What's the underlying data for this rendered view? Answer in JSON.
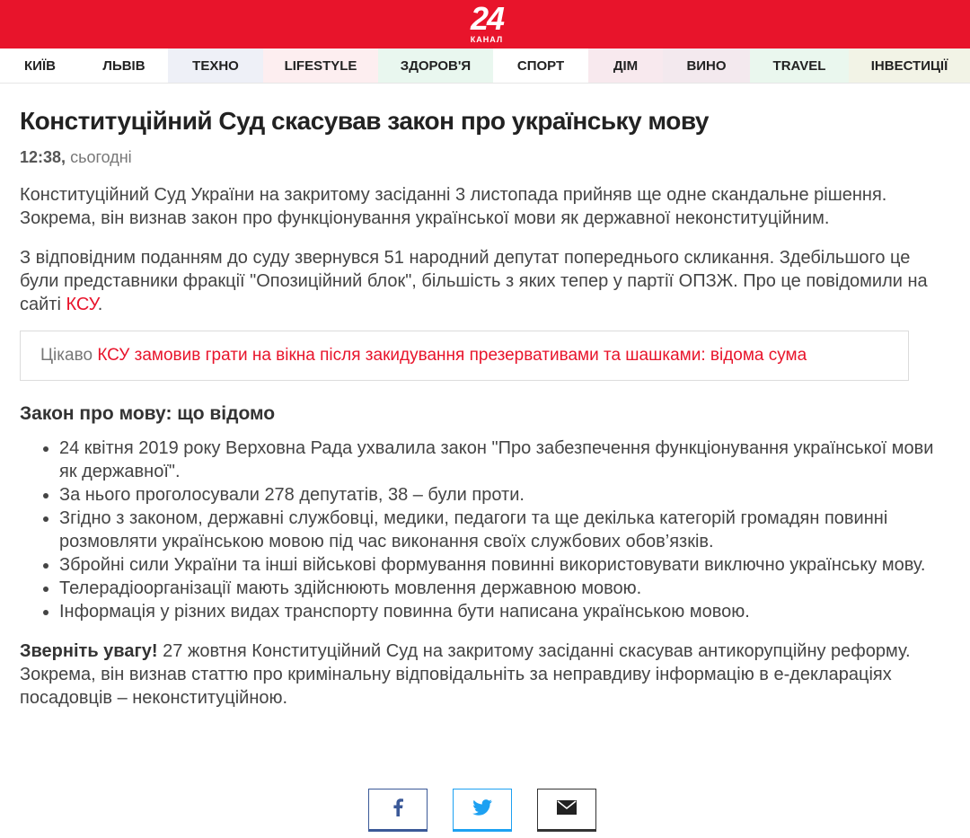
{
  "brand": {
    "logo_number": "24",
    "logo_sub": "КАНАЛ",
    "color": "#e8142b"
  },
  "nav": [
    {
      "label": "Київ",
      "bg": "#ffffff",
      "width": 89
    },
    {
      "label": "Львів",
      "bg": "#ffffff",
      "width": 98
    },
    {
      "label": "Техно",
      "bg": "#eef0f7",
      "width": 106
    },
    {
      "label": "Lifestyle",
      "bg": "#fdeef0",
      "width": 128
    },
    {
      "label": "Здоров'я",
      "bg": "#e9f7ef",
      "width": 128
    },
    {
      "label": "Спорт",
      "bg": "#ffffff",
      "width": 106
    },
    {
      "label": "Дім",
      "bg": "#f8e9ee",
      "width": 83
    },
    {
      "label": "Вино",
      "bg": "#f3e9ee",
      "width": 97
    },
    {
      "label": "Travel",
      "bg": "#eaf7ee",
      "width": 110
    },
    {
      "label": "Інвестиції",
      "bg": "#f2f3e6",
      "width": 135
    }
  ],
  "article": {
    "title": "Конституційний Суд скасував закон про українську мову",
    "time": "12:38,",
    "date": "сьогодні",
    "p1": "Конституційний Суд України на закритому засіданні 3 листопада прийняв ще одне скандальне рішення. Зокрема, він визнав закон про функціонування української мови як державної неконституційним.",
    "p2_text": "З відповідним поданням до суду звернувся 51 народний депутат попереднього скликання. Здебільшого це були представники фракції \"Опозиційний блок\", більшість з яких тепер у партії ОПЗЖ. Про це повідомили на сайті",
    "p2_link": "КСУ",
    "p2_end": ".",
    "interesting_label": "Цікаво",
    "interesting_link": "КСУ замовив грати на вікна після закидування презервативами та шашками: відома сума",
    "section_title": "Закон про мову: що відомо",
    "bullets": [
      "24 квітня 2019 року Верховна Рада ухвалила закон \"Про забезпечення функціонування української мови як державної\".",
      "За нього проголосували 278 депутатів, 38 – були проти.",
      "Згідно з законом, державні службовці, медики, педагоги та ще декілька категорій громадян повинні розмовляти українською мовою під час виконання своїх службових обов’язків.",
      "Збройні сили України та інші військові формування повинні використовувати виключно українську мову.",
      "Телерадіоорганізації мають здійснюють мовлення державною мовою.",
      "Інформація у різних видах транспорту повинна бути написана українською мовою."
    ],
    "note_bold": "Зверніть увагу!",
    "note_text": " 27 жовтня Конституційний Суд на закритому засіданні скасував антикорупційну реформу. Зокрема, він визнав статтю про кримінальну відповідальніть за неправдиву інформацію в е-деклараціях посадовців – неконституційною."
  },
  "share": {
    "facebook_icon": "facebook-icon",
    "twitter_icon": "twitter-icon",
    "email_icon": "email-icon",
    "facebook_color": "#3b5998",
    "twitter_color": "#1da1f2"
  }
}
